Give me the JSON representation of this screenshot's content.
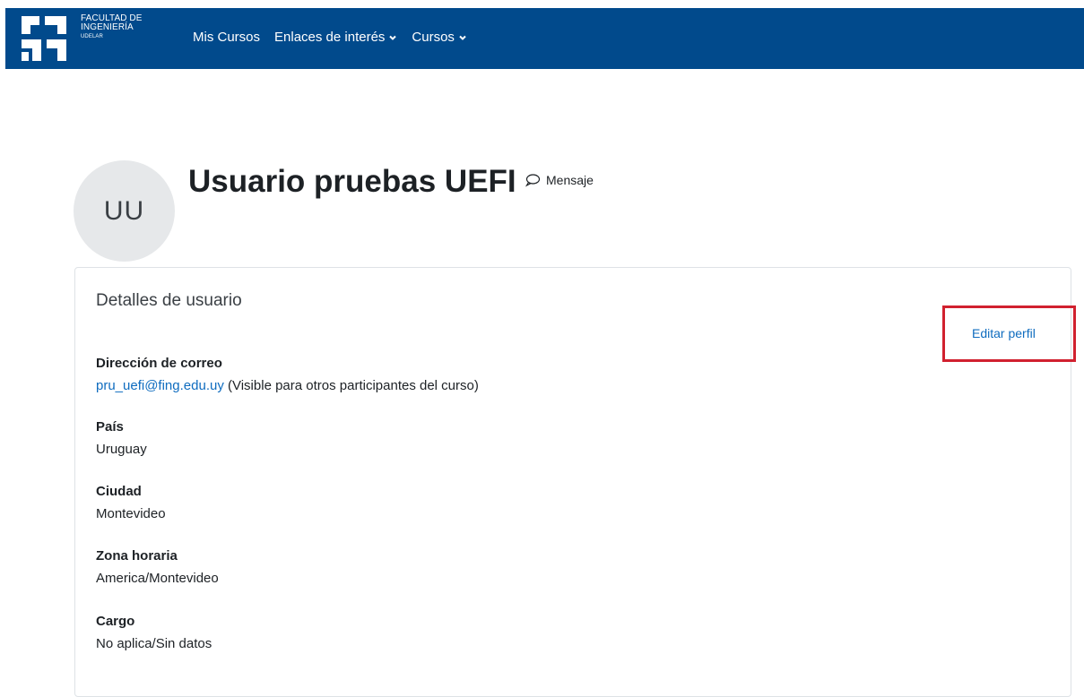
{
  "header": {
    "logo_lines": [
      "FACULTAD DE",
      "INGENIERÍA",
      "UDELAR"
    ],
    "nav": [
      {
        "label": "Mis Cursos"
      },
      {
        "label": "Enlaces de interés"
      },
      {
        "label": "Cursos"
      }
    ]
  },
  "profile": {
    "initials": "UU",
    "name": "Usuario pruebas UEFI",
    "message_label": "Mensaje"
  },
  "details": {
    "title": "Detalles de usuario",
    "edit_label": "Editar perfil",
    "email_label": "Dirección de correo",
    "email": "pru_uefi@fing.edu.uy",
    "email_note": " (Visible para otros participantes del curso)",
    "country_label": "País",
    "country": "Uruguay",
    "city_label": "Ciudad",
    "city": "Montevideo",
    "tz_label": "Zona horaria",
    "tz": "America/Montevideo",
    "role_label": "Cargo",
    "role": "No aplica/Sin datos"
  },
  "colors": {
    "navbar": "#014a8c",
    "link": "#0f6cbf",
    "highlight": "#d1212f"
  }
}
